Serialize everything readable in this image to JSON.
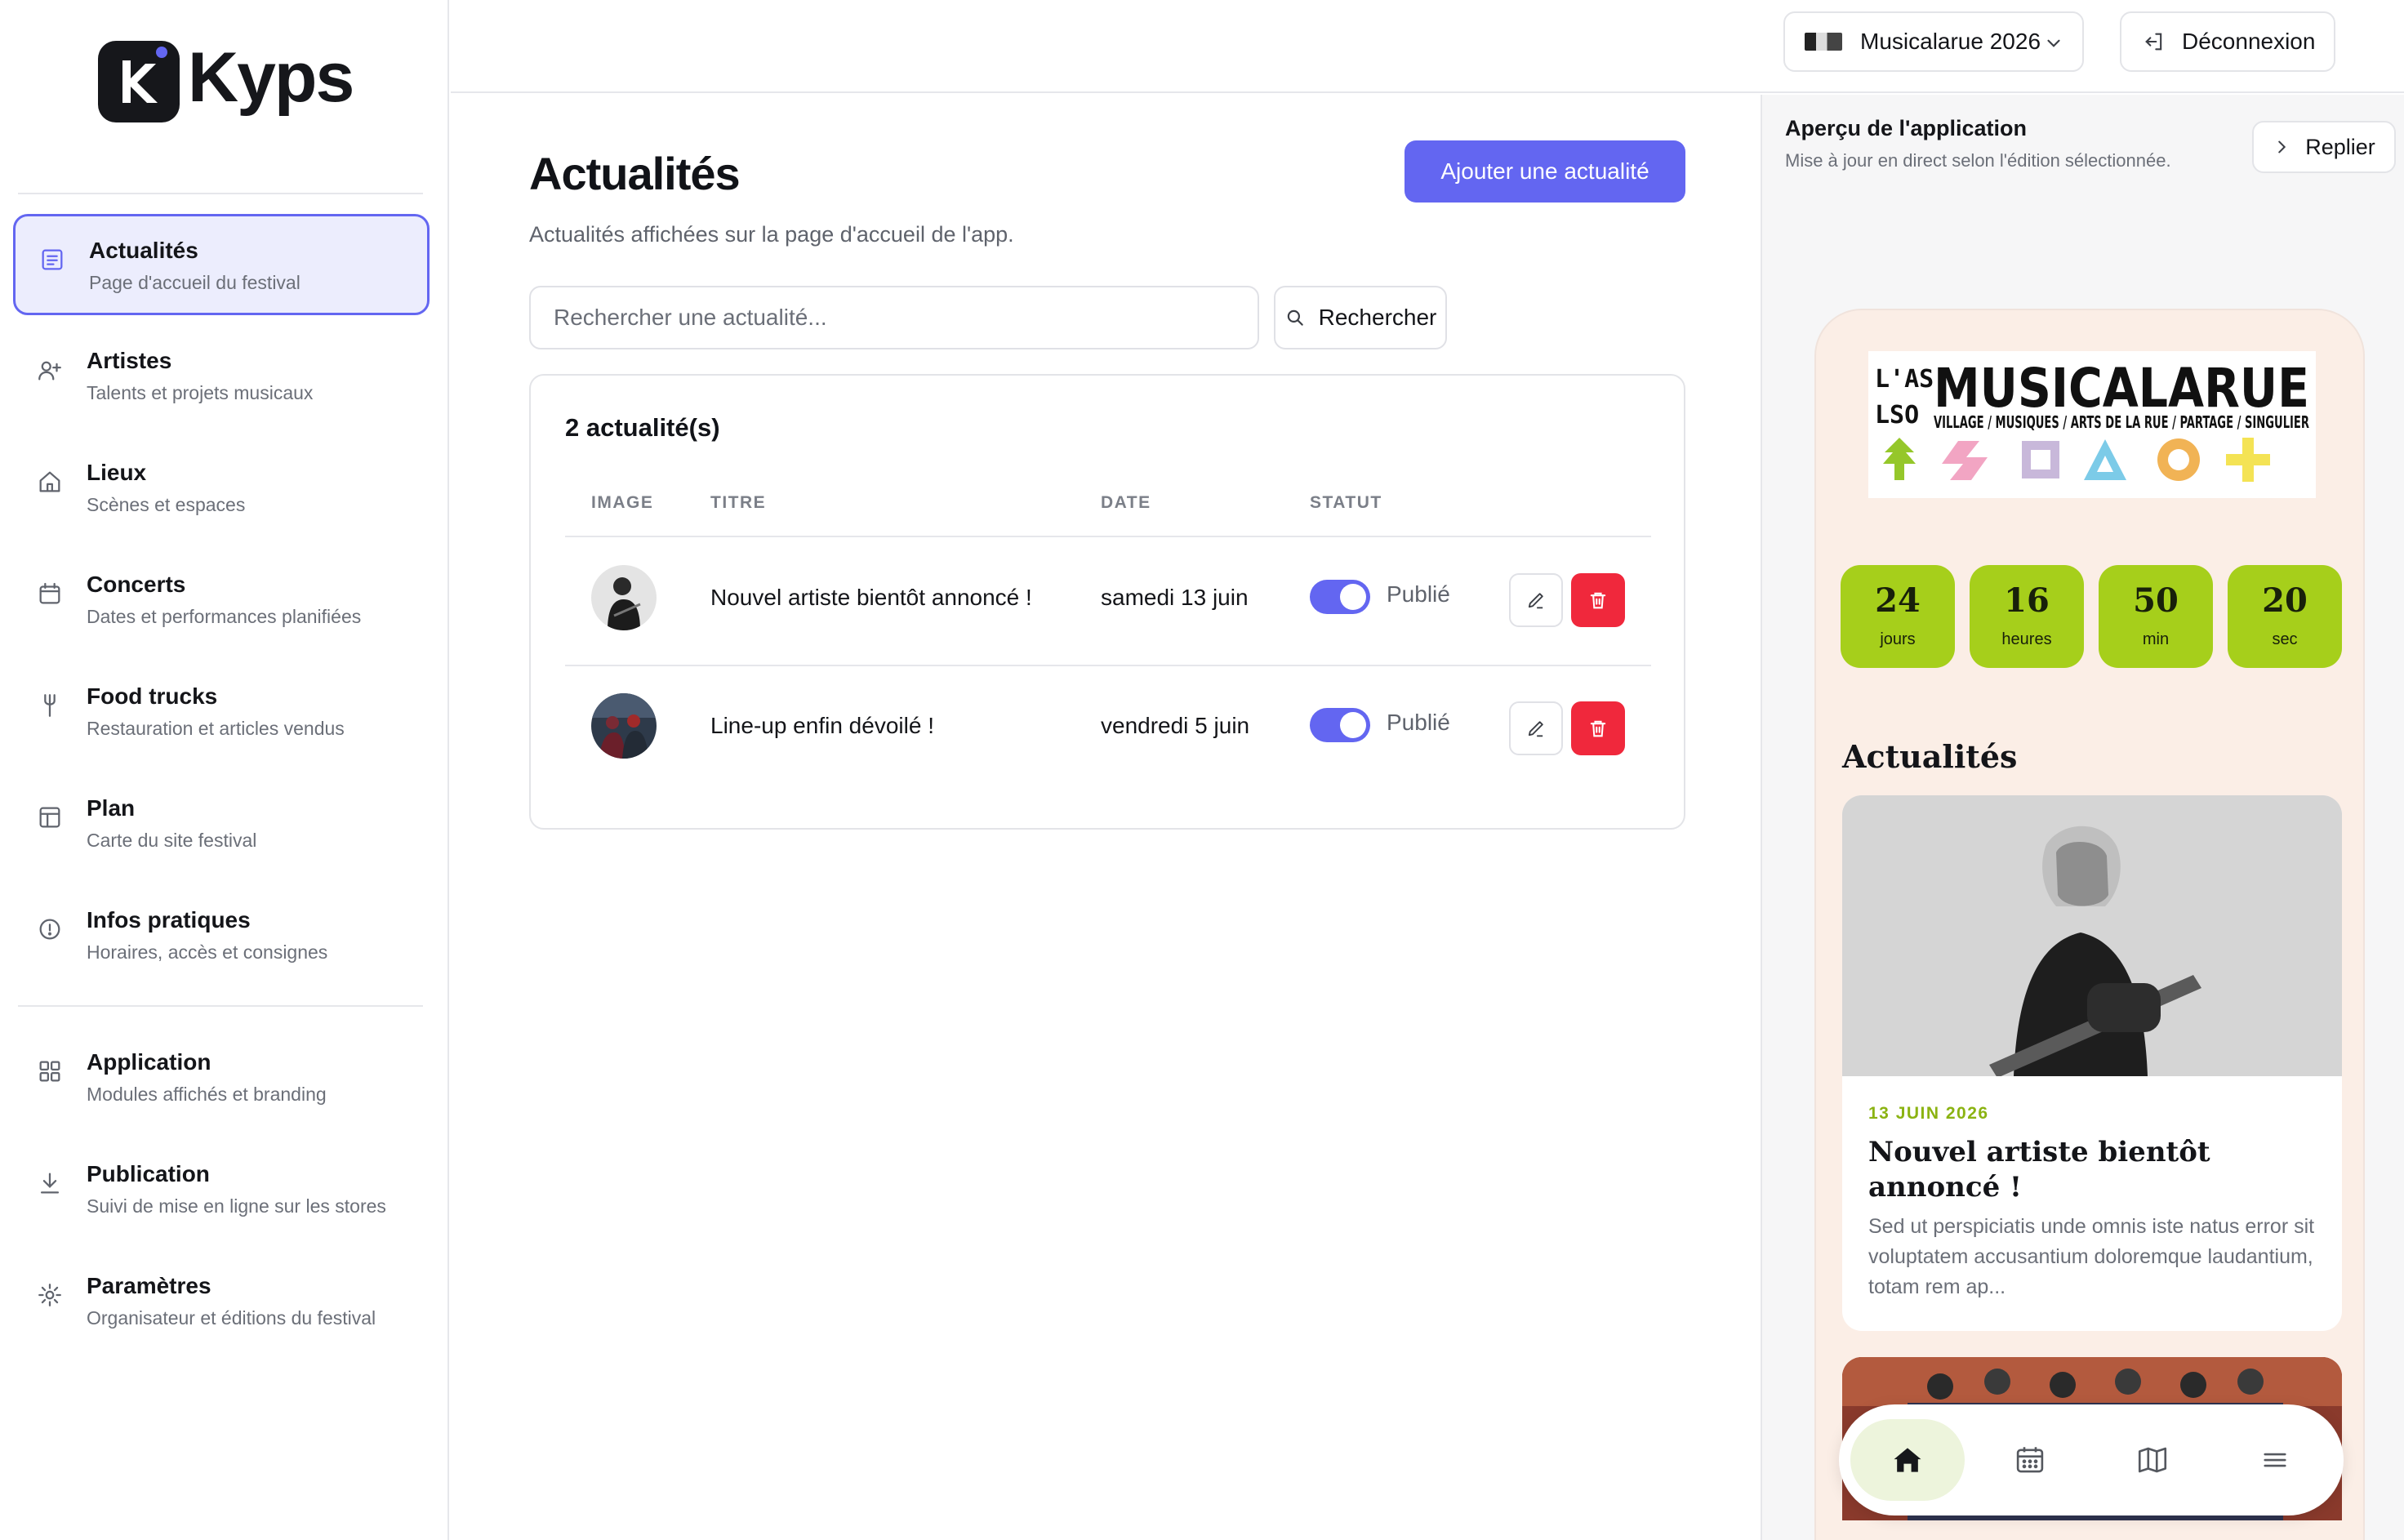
{
  "brand": {
    "name": "Kyps"
  },
  "sidebar": {
    "items": [
      {
        "title": "Actualités",
        "subtitle": "Page d'accueil du festival",
        "icon": "newspaper-icon",
        "active": true
      },
      {
        "title": "Artistes",
        "subtitle": "Talents et projets musicaux",
        "icon": "user-plus-icon"
      },
      {
        "title": "Lieux",
        "subtitle": "Scènes et espaces",
        "icon": "home-icon"
      },
      {
        "title": "Concerts",
        "subtitle": "Dates et performances planifiées",
        "icon": "calendar-icon"
      },
      {
        "title": "Food trucks",
        "subtitle": "Restauration et articles vendus",
        "icon": "fork-icon"
      },
      {
        "title": "Plan",
        "subtitle": "Carte du site festival",
        "icon": "layout-icon"
      },
      {
        "title": "Infos pratiques",
        "subtitle": "Horaires, accès et consignes",
        "icon": "info-icon"
      },
      {
        "title": "Application",
        "subtitle": "Modules affichés et branding",
        "icon": "grid-icon"
      },
      {
        "title": "Publication",
        "subtitle": "Suivi de mise en ligne sur les stores",
        "icon": "download-icon"
      },
      {
        "title": "Paramètres",
        "subtitle": "Organisateur et éditions du festival",
        "icon": "gear-icon"
      }
    ]
  },
  "topbar": {
    "edition": "Musicalarue 2026",
    "logout": "Déconnexion"
  },
  "main": {
    "title": "Actualités",
    "subtitle": "Actualités affichées sur la page d'accueil de l'app.",
    "add_button": "Ajouter une actualité",
    "search": {
      "placeholder": "Rechercher une actualité...",
      "button": "Rechercher"
    },
    "table": {
      "count_label": "2 actualité(s)",
      "columns": [
        "IMAGE",
        "TITRE",
        "DATE",
        "STATUT"
      ],
      "rows": [
        {
          "title": "Nouvel artiste bientôt annoncé !",
          "date": "samedi 13 juin",
          "status": "Publié",
          "published": true
        },
        {
          "title": "Line-up enfin dévoilé !",
          "date": "vendredi 5 juin",
          "status": "Publié",
          "published": true
        }
      ]
    }
  },
  "preview": {
    "title": "Aperçu de l'application",
    "subtitle": "Mise à jour en direct selon l'édition sélectionnée.",
    "collapse": "Replier",
    "countdown": [
      {
        "value": "24",
        "unit": "jours"
      },
      {
        "value": "16",
        "unit": "heures"
      },
      {
        "value": "50",
        "unit": "min"
      },
      {
        "value": "20",
        "unit": "sec"
      }
    ],
    "section_title": "Actualités",
    "news": {
      "date": "13 JUIN 2026",
      "title": "Nouvel artiste bientôt annoncé !",
      "excerpt": "Sed ut perspiciatis unde omnis iste natus error sit voluptatem accusantium doloremque laudantium, totam rem ap..."
    },
    "festival_logo": {
      "line1": "L'ASSO",
      "name": "MUSICALARUE",
      "tagline": "VILLAGE / MUSIQUES / ARTS DE LA RUE / PARTAGE / SINGULIER"
    },
    "tabs": [
      "home-icon",
      "calendar-icon",
      "map-icon",
      "menu-icon"
    ],
    "colors": {
      "accent": "#6366f1",
      "countdown": "#a6cf1b",
      "news_date": "#8bb312",
      "delete": "#f0283c"
    }
  }
}
